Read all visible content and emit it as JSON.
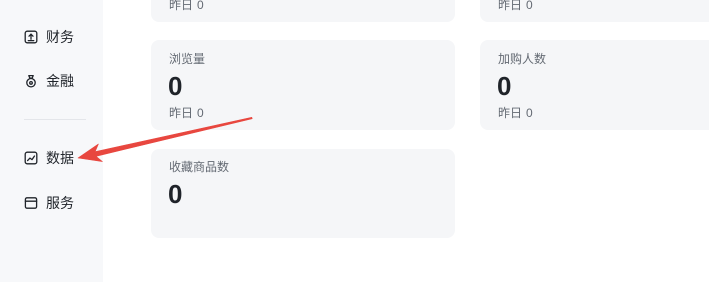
{
  "sidebar": {
    "items": [
      {
        "label": "财务",
        "icon": "finance-icon"
      },
      {
        "label": "金融",
        "icon": "money-bag-icon"
      },
      {
        "label": "数据",
        "icon": "data-chart-icon"
      },
      {
        "label": "服务",
        "icon": "service-window-icon"
      }
    ]
  },
  "stats": {
    "top_left": {
      "yesterday_label": "昨日",
      "yesterday_value": "0"
    },
    "top_right": {
      "yesterday_label": "昨日",
      "yesterday_value": "0"
    },
    "page_views": {
      "title": "浏览量",
      "value": "0",
      "yesterday_label": "昨日",
      "yesterday_value": "0"
    },
    "add_to_cart_users": {
      "title": "加购人数",
      "value": "0",
      "yesterday_label": "昨日",
      "yesterday_value": "0"
    },
    "favorited_products": {
      "title": "收藏商品数",
      "value": "0"
    }
  },
  "colors": {
    "sidebar_bg": "#f7f8fa",
    "card_bg": "#f5f6f8",
    "text_primary": "#1f2329",
    "text_secondary": "#646a73",
    "annotation_red": "#e8473f"
  }
}
